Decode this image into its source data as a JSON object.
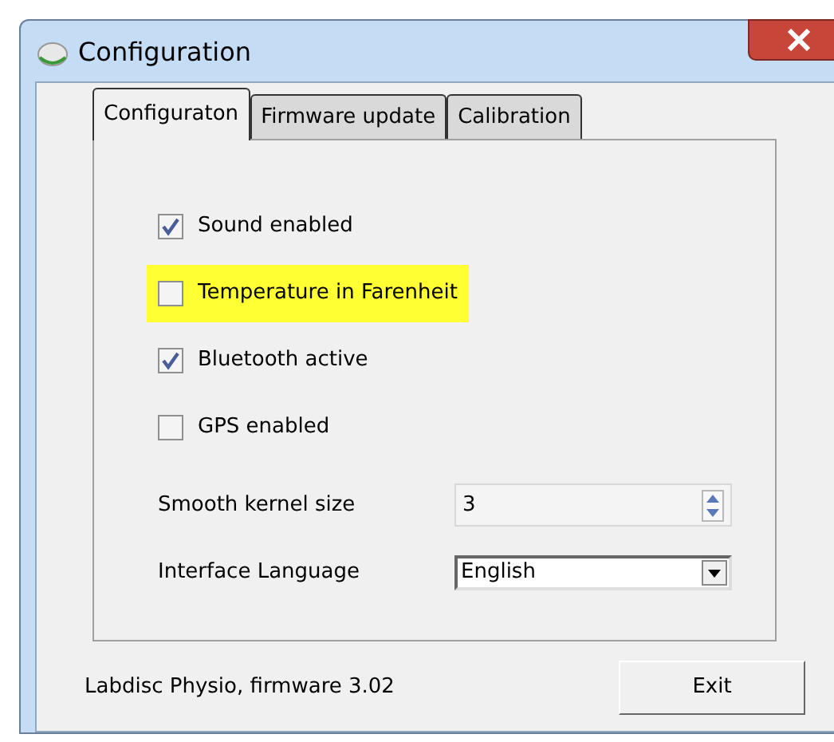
{
  "window": {
    "title": "Configuration"
  },
  "tabs": [
    {
      "label": "Configuraton",
      "selected": true
    },
    {
      "label": "Firmware update",
      "selected": false
    },
    {
      "label": "Calibration",
      "selected": false
    }
  ],
  "options": [
    {
      "label": "Sound enabled",
      "checked": true,
      "highlighted": false
    },
    {
      "label": "Temperature in Farenheit",
      "checked": false,
      "highlighted": true
    },
    {
      "label": "Bluetooth active",
      "checked": true,
      "highlighted": false
    },
    {
      "label": "GPS enabled",
      "checked": false,
      "highlighted": false
    }
  ],
  "smooth_kernel": {
    "label": "Smooth kernel size",
    "value": "3"
  },
  "language": {
    "label": "Interface Language",
    "value": "English"
  },
  "status": "Labdisc Physio, firmware 3.02",
  "exit_button": "Exit"
}
